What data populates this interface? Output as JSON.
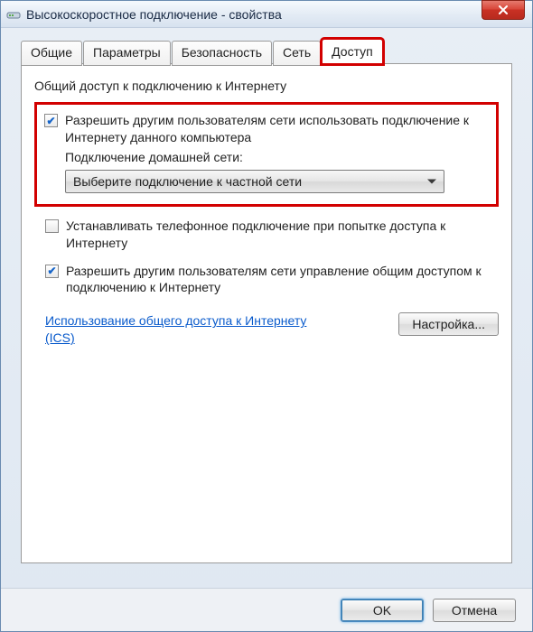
{
  "window": {
    "title": "Высокоскоростное подключение - свойства"
  },
  "tabs": {
    "general": "Общие",
    "parameters": "Параметры",
    "security": "Безопасность",
    "network": "Сеть",
    "access": "Доступ"
  },
  "group": {
    "title": "Общий доступ к подключению к Интернету"
  },
  "allow_share": {
    "label": "Разрешить другим пользователям сети использовать подключение к Интернету данного компьютера",
    "sublabel": "Подключение домашней сети:",
    "dropdown_value": "Выберите подключение к частной сети"
  },
  "dial_on_demand": {
    "label": "Устанавливать телефонное подключение при попытке доступа к Интернету"
  },
  "allow_control": {
    "label": "Разрешить другим пользователям сети управление общим доступом к подключению к Интернету"
  },
  "link": {
    "text": "Использование общего доступа к Интернету (ICS)"
  },
  "buttons": {
    "settings": "Настройка...",
    "ok": "OK",
    "cancel": "Отмена"
  }
}
